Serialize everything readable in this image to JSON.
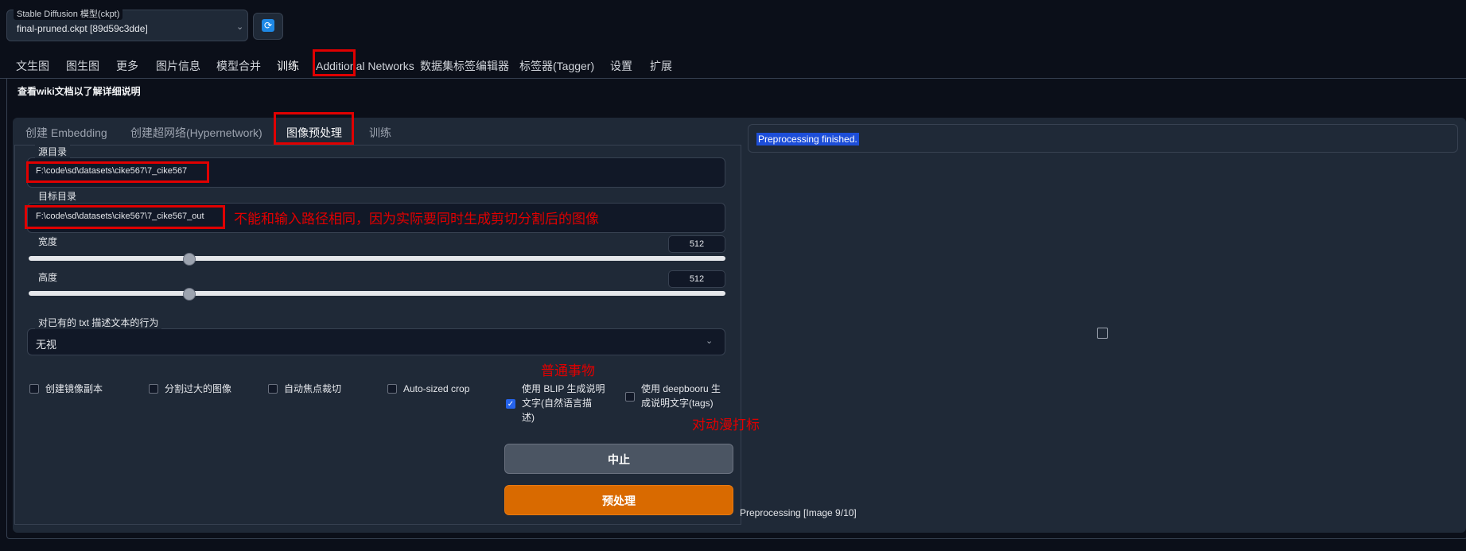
{
  "model": {
    "label": "Stable Diffusion 模型(ckpt)",
    "selected": "final-pruned.ckpt [89d59c3dde]",
    "refresh_icon": "refresh-icon"
  },
  "top_tabs": [
    {
      "label": "文生图"
    },
    {
      "label": "图生图"
    },
    {
      "label": "更多"
    },
    {
      "label": "图片信息"
    },
    {
      "label": "模型合并"
    },
    {
      "label": "训练"
    },
    {
      "label": "Additional Networks"
    },
    {
      "label": "数据集标签编辑器"
    },
    {
      "label": "标签器(Tagger)"
    },
    {
      "label": "设置"
    },
    {
      "label": "扩展"
    }
  ],
  "wiki_text": "查看wiki文档以了解详细说明",
  "sub_tabs": [
    {
      "label": "创建 Embedding"
    },
    {
      "label": "创建超网络(Hypernetwork)"
    },
    {
      "label": "图像预处理"
    },
    {
      "label": "训练"
    }
  ],
  "source": {
    "label": "源目录",
    "value": "F:\\code\\sd\\datasets\\cike567\\7_cike567"
  },
  "target": {
    "label": "目标目录",
    "value": "F:\\code\\sd\\datasets\\cike567\\7_cike567_out"
  },
  "width": {
    "label": "宽度",
    "value": "512",
    "fraction": 0.23
  },
  "height": {
    "label": "高度",
    "value": "512",
    "fraction": 0.23
  },
  "caption_action": {
    "label": "对已有的 txt 描述文本的行为",
    "selected": "无视"
  },
  "checkboxes": [
    {
      "label": "创建镜像副本",
      "checked": false
    },
    {
      "label": "分割过大的图像",
      "checked": false
    },
    {
      "label": "自动焦点裁切",
      "checked": false
    },
    {
      "label": "Auto-sized crop",
      "checked": false
    },
    {
      "label": "使用 BLIP 生成说明文字(自然语言描述)",
      "line1": "使用 BLIP 生成说明",
      "line2": "文字(自然语言描",
      "line3": "述)",
      "checked": true
    },
    {
      "label": "使用 deepbooru 生成说明文字(tags)",
      "line1": "使用 deepbooru 生",
      "line2": "成说明文字(tags)",
      "checked": false
    }
  ],
  "buttons": {
    "stop": "中止",
    "preprocess": "预处理"
  },
  "status": "Preprocessing finished.",
  "progress": "Preprocessing [Image 9/10]",
  "annotations": {
    "path_note": "不能和输入路径相同，因为实际要同时生成剪切分割后的图像",
    "common_objects": "普通事物",
    "anime": "对动漫打标"
  }
}
